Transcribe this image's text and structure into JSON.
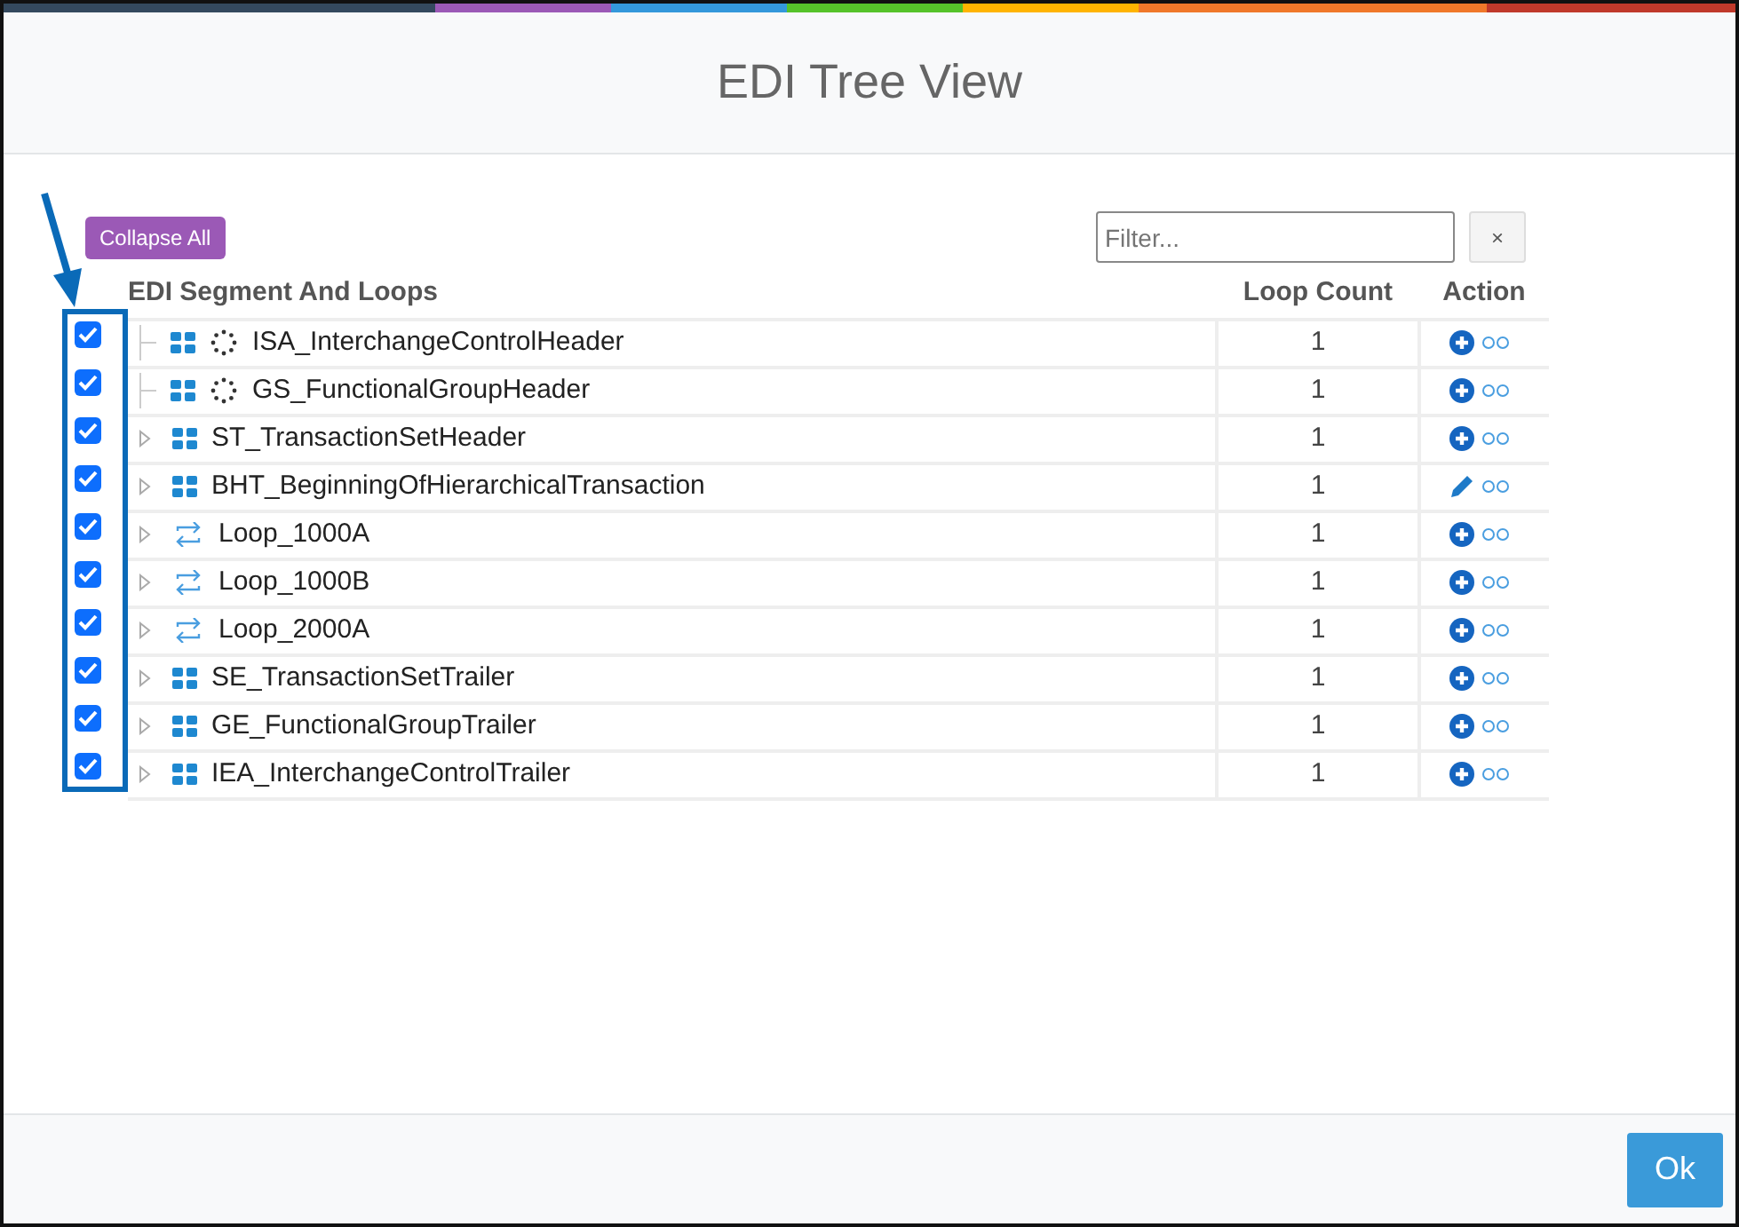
{
  "window": {
    "title": "EDI Tree View"
  },
  "collapse_button": "Collapse All",
  "filter": {
    "placeholder": "Filter...",
    "clear": "×"
  },
  "columns": [
    "EDI Segment And Loops",
    "Loop Count",
    "Action"
  ],
  "rows": [
    {
      "checked": true,
      "kind": "segment",
      "expandable": false,
      "pending": true,
      "name": "ISA_InterchangeControlHeader",
      "loop_count": "1",
      "action": {
        "kind": "add"
      }
    },
    {
      "checked": true,
      "kind": "segment",
      "expandable": false,
      "pending": true,
      "name": "GS_FunctionalGroupHeader",
      "loop_count": "1",
      "action": {
        "kind": "add"
      }
    },
    {
      "checked": true,
      "kind": "segment",
      "expandable": true,
      "pending": false,
      "name": "ST_TransactionSetHeader",
      "loop_count": "1",
      "action": {
        "kind": "add"
      }
    },
    {
      "checked": true,
      "kind": "segment",
      "expandable": true,
      "pending": false,
      "name": "BHT_BeginningOfHierarchicalTransaction",
      "loop_count": "1",
      "action": {
        "kind": "edit"
      }
    },
    {
      "checked": true,
      "kind": "loop",
      "expandable": true,
      "pending": false,
      "name": "Loop_1000A",
      "loop_count": "1",
      "action": {
        "kind": "add"
      }
    },
    {
      "checked": true,
      "kind": "loop",
      "expandable": true,
      "pending": false,
      "name": "Loop_1000B",
      "loop_count": "1",
      "action": {
        "kind": "add"
      }
    },
    {
      "checked": true,
      "kind": "loop",
      "expandable": true,
      "pending": false,
      "name": "Loop_2000A",
      "loop_count": "1",
      "action": {
        "kind": "add"
      }
    },
    {
      "checked": true,
      "kind": "segment",
      "expandable": true,
      "pending": false,
      "name": "SE_TransactionSetTrailer",
      "loop_count": "1",
      "action": {
        "kind": "add"
      }
    },
    {
      "checked": true,
      "kind": "segment",
      "expandable": true,
      "pending": false,
      "name": "GE_FunctionalGroupTrailer",
      "loop_count": "1",
      "action": {
        "kind": "add"
      }
    },
    {
      "checked": true,
      "kind": "segment",
      "expandable": true,
      "pending": false,
      "name": "IEA_InterchangeControlTrailer",
      "loop_count": "1",
      "action": {
        "kind": "add"
      }
    }
  ],
  "ok_button": "Ok"
}
